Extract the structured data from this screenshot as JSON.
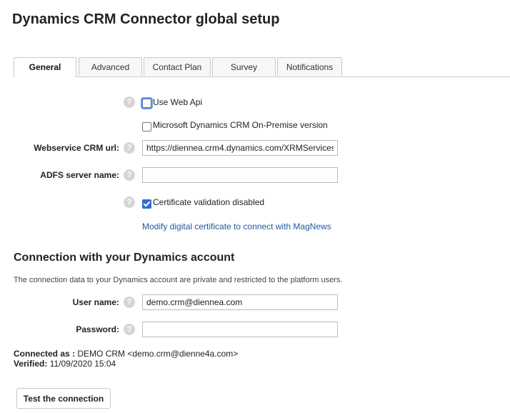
{
  "page": {
    "title": "Dynamics CRM Connector global setup"
  },
  "tabs": [
    {
      "label": "General",
      "active": true
    },
    {
      "label": "Advanced",
      "active": false
    },
    {
      "label": "Contact Plan",
      "active": false
    },
    {
      "label": "Survey",
      "active": false
    },
    {
      "label": "Notifications",
      "active": false
    }
  ],
  "general": {
    "use_web_api": {
      "label": "Use Web Api",
      "checked": false
    },
    "on_premise": {
      "label": "Microsoft Dynamics CRM On-Premise version",
      "checked": false
    },
    "webservice_url": {
      "label": "Webservice CRM url:",
      "value": "https://diennea.crm4.dynamics.com/XRMServices"
    },
    "adfs_server": {
      "label": "ADFS server name:",
      "value": ""
    },
    "cert_validation": {
      "label": "Certificate validation disabled",
      "checked": true
    },
    "modify_cert_link": "Modify digital certificate to connect with MagNews"
  },
  "connection": {
    "title": "Connection with your Dynamics account",
    "description": "The connection data to your Dynamics account are private and restricted to the platform users.",
    "username": {
      "label": "User name:",
      "value": "demo.crm@diennea.com"
    },
    "password": {
      "label": "Password:",
      "value": ""
    },
    "connected_as_label": "Connected as :",
    "connected_as_value": "DEMO CRM <demo.crm@dienne4a.com>",
    "verified_label": "Verified:",
    "verified_value": "11/09/2020 15:04",
    "test_button": "Test the connection"
  },
  "icons": {
    "help": "question-mark-icon"
  },
  "colors": {
    "accent": "#2f6fd6",
    "link": "#1f5a9c"
  }
}
